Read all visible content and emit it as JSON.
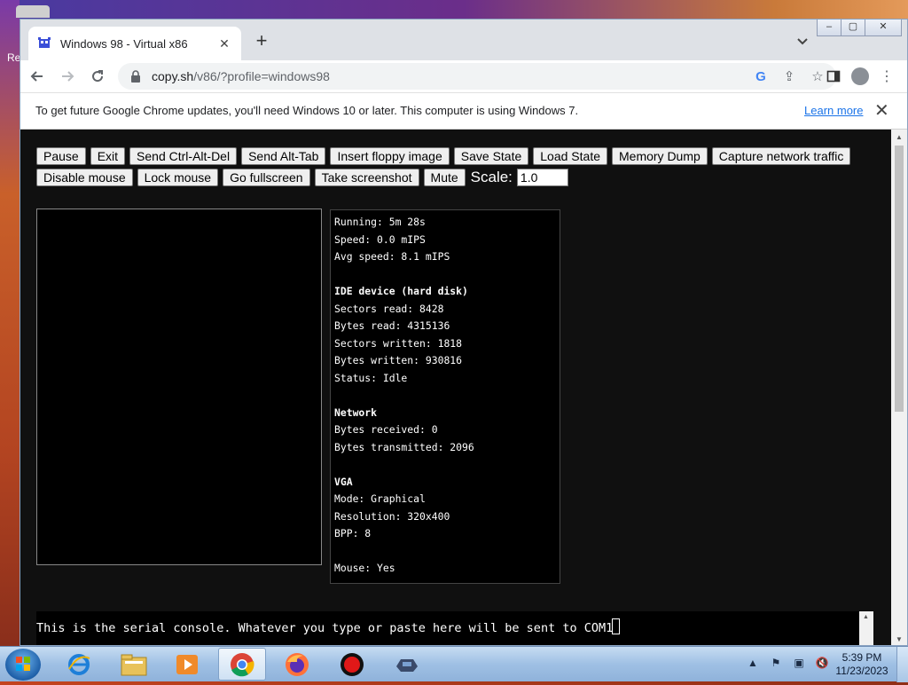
{
  "desktop": {
    "partial_label": "Re"
  },
  "browser": {
    "tab_title": "Windows 98 - Virtual x86",
    "new_tab_symbol": "+",
    "url_host": "copy.sh",
    "url_path": "/v86/?profile=windows98",
    "window_buttons": {
      "minimize": "–",
      "maximize": "▢",
      "close": "✕"
    },
    "info_bar": {
      "message": "To get future Google Chrome updates, you'll need Windows 10 or later. This computer is using Windows 7.",
      "link": "Learn more",
      "close": "✕"
    }
  },
  "emulator": {
    "row1_buttons": [
      "Pause",
      "Exit",
      "Send Ctrl-Alt-Del",
      "Send Alt-Tab",
      "Insert floppy image",
      "Save State",
      "Load State",
      "Memory Dump",
      "Capture network traffic"
    ],
    "row2_buttons": [
      "Disable mouse",
      "Lock mouse",
      "Go fullscreen",
      "Take screenshot",
      "Mute"
    ],
    "scale_label": "Scale:",
    "scale_value": "1.0",
    "stats": {
      "running": "Running: 5m 28s",
      "speed": "Speed: 0.0 mIPS",
      "avg_speed": "Avg speed: 8.1 mIPS",
      "ide_header": "IDE device (hard disk)",
      "sectors_read": "Sectors read: 8428",
      "bytes_read": "Bytes read: 4315136",
      "sectors_written": "Sectors written: 1818",
      "bytes_written": "Bytes written: 930816",
      "status": "Status: Idle",
      "network_header": "Network",
      "bytes_received": "Bytes received: 0",
      "bytes_transmitted": "Bytes transmitted: 2096",
      "vga_header": "VGA",
      "mode": "Mode: Graphical",
      "resolution": "Resolution: 320x400",
      "bpp": "BPP: 8",
      "mouse": "Mouse: Yes"
    },
    "serial_console": "This is the serial console. Whatever you type or paste here will be sent to COM1"
  },
  "taskbar": {
    "time": "5:39 PM",
    "date": "11/23/2023",
    "pinned": [
      "internet-explorer",
      "file-explorer",
      "media-player",
      "chrome",
      "firefox",
      "recorder",
      "network-app"
    ]
  }
}
